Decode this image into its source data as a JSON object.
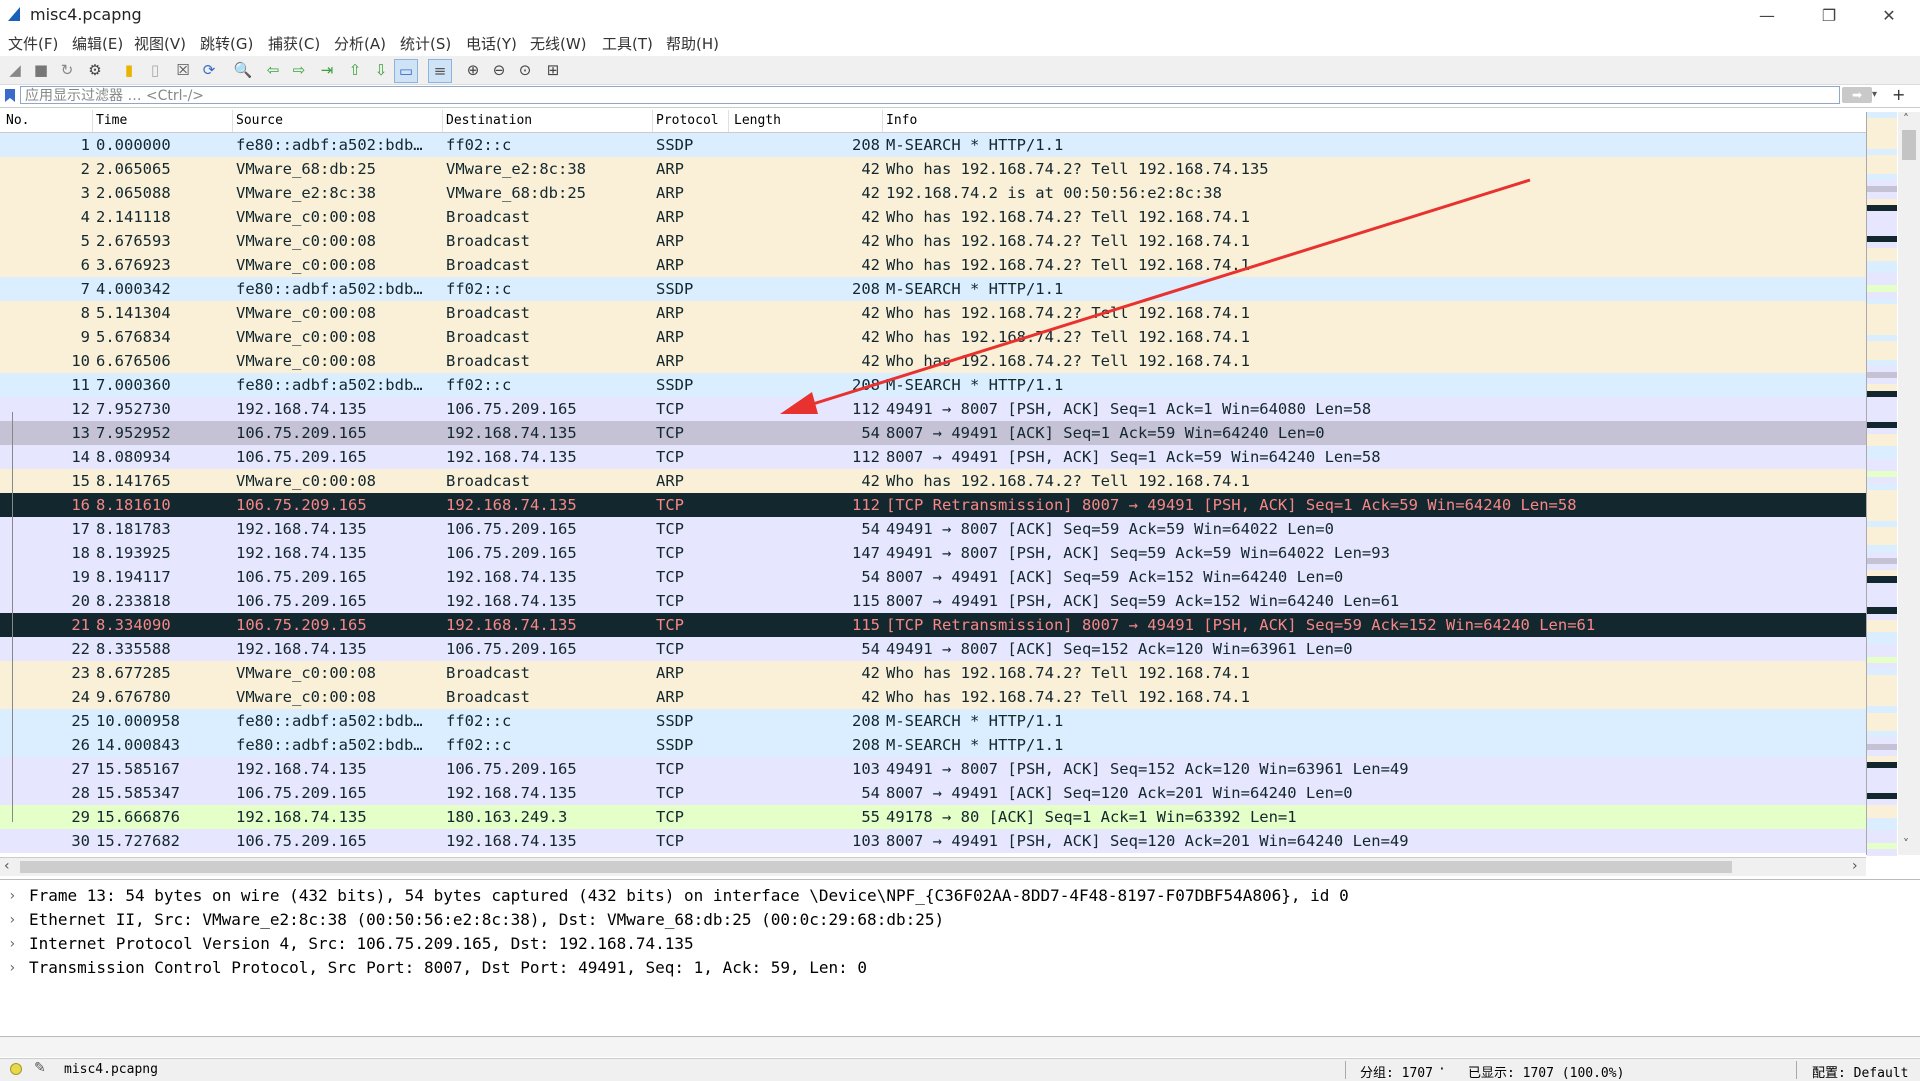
{
  "window": {
    "title": "misc4.pcapng"
  },
  "menu": [
    "文件(F)",
    "编辑(E)",
    "视图(V)",
    "跳转(G)",
    "捕获(C)",
    "分析(A)",
    "统计(S)",
    "电话(Y)",
    "无线(W)",
    "工具(T)",
    "帮助(H)"
  ],
  "toolbar_icons": [
    "start-capture-icon",
    "stop-capture-icon",
    "restart-capture-icon",
    "capture-options-icon",
    "open-file-icon",
    "save-file-icon",
    "close-file-icon",
    "reload-file-icon",
    "find-packet-icon",
    "go-back-icon",
    "go-forward-icon",
    "go-to-packet-icon",
    "go-first-icon",
    "go-last-icon",
    "auto-scroll-icon",
    "colorize-icon",
    "zoom-in-icon",
    "zoom-out-icon",
    "zoom-normal-icon",
    "resize-columns-icon"
  ],
  "filter": {
    "placeholder": "应用显示过滤器 … <Ctrl-/>"
  },
  "columns": [
    "No.",
    "Time",
    "Source",
    "Destination",
    "Protocol",
    "Length",
    "Info"
  ],
  "packets": [
    {
      "no": "1",
      "time": "0.000000",
      "src": "fe80::adbf:a502:bdb…",
      "dst": "ff02::c",
      "proto": "SSDP",
      "len": "208",
      "info": "M-SEARCH * HTTP/1.1",
      "style": "ssdp"
    },
    {
      "no": "2",
      "time": "2.065065",
      "src": "VMware_68:db:25",
      "dst": "VMware_e2:8c:38",
      "proto": "ARP",
      "len": "42",
      "info": "Who has 192.168.74.2? Tell 192.168.74.135",
      "style": "arp"
    },
    {
      "no": "3",
      "time": "2.065088",
      "src": "VMware_e2:8c:38",
      "dst": "VMware_68:db:25",
      "proto": "ARP",
      "len": "42",
      "info": "192.168.74.2 is at 00:50:56:e2:8c:38",
      "style": "arp"
    },
    {
      "no": "4",
      "time": "2.141118",
      "src": "VMware_c0:00:08",
      "dst": "Broadcast",
      "proto": "ARP",
      "len": "42",
      "info": "Who has 192.168.74.2? Tell 192.168.74.1",
      "style": "arp"
    },
    {
      "no": "5",
      "time": "2.676593",
      "src": "VMware_c0:00:08",
      "dst": "Broadcast",
      "proto": "ARP",
      "len": "42",
      "info": "Who has 192.168.74.2? Tell 192.168.74.1",
      "style": "arp"
    },
    {
      "no": "6",
      "time": "3.676923",
      "src": "VMware_c0:00:08",
      "dst": "Broadcast",
      "proto": "ARP",
      "len": "42",
      "info": "Who has 192.168.74.2? Tell 192.168.74.1",
      "style": "arp"
    },
    {
      "no": "7",
      "time": "4.000342",
      "src": "fe80::adbf:a502:bdb…",
      "dst": "ff02::c",
      "proto": "SSDP",
      "len": "208",
      "info": "M-SEARCH * HTTP/1.1",
      "style": "ssdp"
    },
    {
      "no": "8",
      "time": "5.141304",
      "src": "VMware_c0:00:08",
      "dst": "Broadcast",
      "proto": "ARP",
      "len": "42",
      "info": "Who has 192.168.74.2? Tell 192.168.74.1",
      "style": "arp"
    },
    {
      "no": "9",
      "time": "5.676834",
      "src": "VMware_c0:00:08",
      "dst": "Broadcast",
      "proto": "ARP",
      "len": "42",
      "info": "Who has 192.168.74.2? Tell 192.168.74.1",
      "style": "arp"
    },
    {
      "no": "10",
      "time": "6.676506",
      "src": "VMware_c0:00:08",
      "dst": "Broadcast",
      "proto": "ARP",
      "len": "42",
      "info": "Who has 192.168.74.2? Tell 192.168.74.1",
      "style": "arp"
    },
    {
      "no": "11",
      "time": "7.000360",
      "src": "fe80::adbf:a502:bdb…",
      "dst": "ff02::c",
      "proto": "SSDP",
      "len": "208",
      "info": "M-SEARCH * HTTP/1.1",
      "style": "ssdp"
    },
    {
      "no": "12",
      "time": "7.952730",
      "src": "192.168.74.135",
      "dst": "106.75.209.165",
      "proto": "TCP",
      "len": "112",
      "info": "49491 → 8007 [PSH, ACK] Seq=1 Ack=1 Win=64080 Len=58",
      "style": "tcp"
    },
    {
      "no": "13",
      "time": "7.952952",
      "src": "106.75.209.165",
      "dst": "192.168.74.135",
      "proto": "TCP",
      "len": "54",
      "info": "8007 → 49491 [ACK] Seq=1 Ack=59 Win=64240 Len=0",
      "style": "selected"
    },
    {
      "no": "14",
      "time": "8.080934",
      "src": "106.75.209.165",
      "dst": "192.168.74.135",
      "proto": "TCP",
      "len": "112",
      "info": "8007 → 49491 [PSH, ACK] Seq=1 Ack=59 Win=64240 Len=58",
      "style": "tcp"
    },
    {
      "no": "15",
      "time": "8.141765",
      "src": "VMware_c0:00:08",
      "dst": "Broadcast",
      "proto": "ARP",
      "len": "42",
      "info": "Who has 192.168.74.2? Tell 192.168.74.1",
      "style": "arp"
    },
    {
      "no": "16",
      "time": "8.181610",
      "src": "106.75.209.165",
      "dst": "192.168.74.135",
      "proto": "TCP",
      "len": "112",
      "info": "[TCP Retransmission] 8007 → 49491 [PSH, ACK] Seq=1 Ack=59 Win=64240 Len=58",
      "style": "bad"
    },
    {
      "no": "17",
      "time": "8.181783",
      "src": "192.168.74.135",
      "dst": "106.75.209.165",
      "proto": "TCP",
      "len": "54",
      "info": "49491 → 8007 [ACK] Seq=59 Ack=59 Win=64022 Len=0",
      "style": "tcp"
    },
    {
      "no": "18",
      "time": "8.193925",
      "src": "192.168.74.135",
      "dst": "106.75.209.165",
      "proto": "TCP",
      "len": "147",
      "info": "49491 → 8007 [PSH, ACK] Seq=59 Ack=59 Win=64022 Len=93",
      "style": "tcp"
    },
    {
      "no": "19",
      "time": "8.194117",
      "src": "106.75.209.165",
      "dst": "192.168.74.135",
      "proto": "TCP",
      "len": "54",
      "info": "8007 → 49491 [ACK] Seq=59 Ack=152 Win=64240 Len=0",
      "style": "tcp"
    },
    {
      "no": "20",
      "time": "8.233818",
      "src": "106.75.209.165",
      "dst": "192.168.74.135",
      "proto": "TCP",
      "len": "115",
      "info": "8007 → 49491 [PSH, ACK] Seq=59 Ack=152 Win=64240 Len=61",
      "style": "tcp"
    },
    {
      "no": "21",
      "time": "8.334090",
      "src": "106.75.209.165",
      "dst": "192.168.74.135",
      "proto": "TCP",
      "len": "115",
      "info": "[TCP Retransmission] 8007 → 49491 [PSH, ACK] Seq=59 Ack=152 Win=64240 Len=61",
      "style": "bad"
    },
    {
      "no": "22",
      "time": "8.335588",
      "src": "192.168.74.135",
      "dst": "106.75.209.165",
      "proto": "TCP",
      "len": "54",
      "info": "49491 → 8007 [ACK] Seq=152 Ack=120 Win=63961 Len=0",
      "style": "tcp"
    },
    {
      "no": "23",
      "time": "8.677285",
      "src": "VMware_c0:00:08",
      "dst": "Broadcast",
      "proto": "ARP",
      "len": "42",
      "info": "Who has 192.168.74.2? Tell 192.168.74.1",
      "style": "arp"
    },
    {
      "no": "24",
      "time": "9.676780",
      "src": "VMware_c0:00:08",
      "dst": "Broadcast",
      "proto": "ARP",
      "len": "42",
      "info": "Who has 192.168.74.2? Tell 192.168.74.1",
      "style": "arp"
    },
    {
      "no": "25",
      "time": "10.000958",
      "src": "fe80::adbf:a502:bdb…",
      "dst": "ff02::c",
      "proto": "SSDP",
      "len": "208",
      "info": "M-SEARCH * HTTP/1.1",
      "style": "ssdp"
    },
    {
      "no": "26",
      "time": "14.000843",
      "src": "fe80::adbf:a502:bdb…",
      "dst": "ff02::c",
      "proto": "SSDP",
      "len": "208",
      "info": "M-SEARCH * HTTP/1.1",
      "style": "ssdp"
    },
    {
      "no": "27",
      "time": "15.585167",
      "src": "192.168.74.135",
      "dst": "106.75.209.165",
      "proto": "TCP",
      "len": "103",
      "info": "49491 → 8007 [PSH, ACK] Seq=152 Ack=120 Win=63961 Len=49",
      "style": "tcp"
    },
    {
      "no": "28",
      "time": "15.585347",
      "src": "106.75.209.165",
      "dst": "192.168.74.135",
      "proto": "TCP",
      "len": "54",
      "info": "8007 → 49491 [ACK] Seq=120 Ack=201 Win=64240 Len=0",
      "style": "tcp"
    },
    {
      "no": "29",
      "time": "15.666876",
      "src": "192.168.74.135",
      "dst": "180.163.249.3",
      "proto": "TCP",
      "len": "55",
      "info": "49178 → 80 [ACK] Seq=1 Ack=1 Win=63392 Len=1",
      "style": "http"
    },
    {
      "no": "30",
      "time": "15.727682",
      "src": "106.75.209.165",
      "dst": "192.168.74.135",
      "proto": "TCP",
      "len": "103",
      "info": "8007 → 49491 [PSH, ACK] Seq=120 Ack=201 Win=64240 Len=49",
      "style": "tcp"
    }
  ],
  "row_colors": {
    "ssdp": {
      "bg": "#daeeff",
      "fg": "#12272e"
    },
    "arp": {
      "bg": "#faf0d7",
      "fg": "#12272e"
    },
    "tcp": {
      "bg": "#e7e6ff",
      "fg": "#12272e"
    },
    "http": {
      "bg": "#e4ffc7",
      "fg": "#12272e"
    },
    "bad": {
      "bg": "#12272e",
      "fg": "#f78787"
    },
    "selected": {
      "bg": "#c5c2d6",
      "fg": "#12272e"
    }
  },
  "details": [
    "Frame 13: 54 bytes on wire (432 bits), 54 bytes captured (432 bits) on interface \\Device\\NPF_{C36F02AA-8DD7-4F48-8197-F07DBF54A806}, id 0",
    "Ethernet II, Src: VMware_e2:8c:38 (00:50:56:e2:8c:38), Dst: VMware_68:db:25 (00:0c:29:68:db:25)",
    "Internet Protocol Version 4, Src: 106.75.209.165, Dst: 192.168.74.135",
    "Transmission Control Protocol, Src Port: 8007, Dst Port: 49491, Seq: 1, Ack: 59, Len: 0"
  ],
  "status": {
    "file": "misc4.pcapng",
    "packets": "分组: 1707",
    "displayed": "已显示: 1707 (100.0%)",
    "profile": "配置: Default"
  },
  "annotation_color": "#e8322f"
}
